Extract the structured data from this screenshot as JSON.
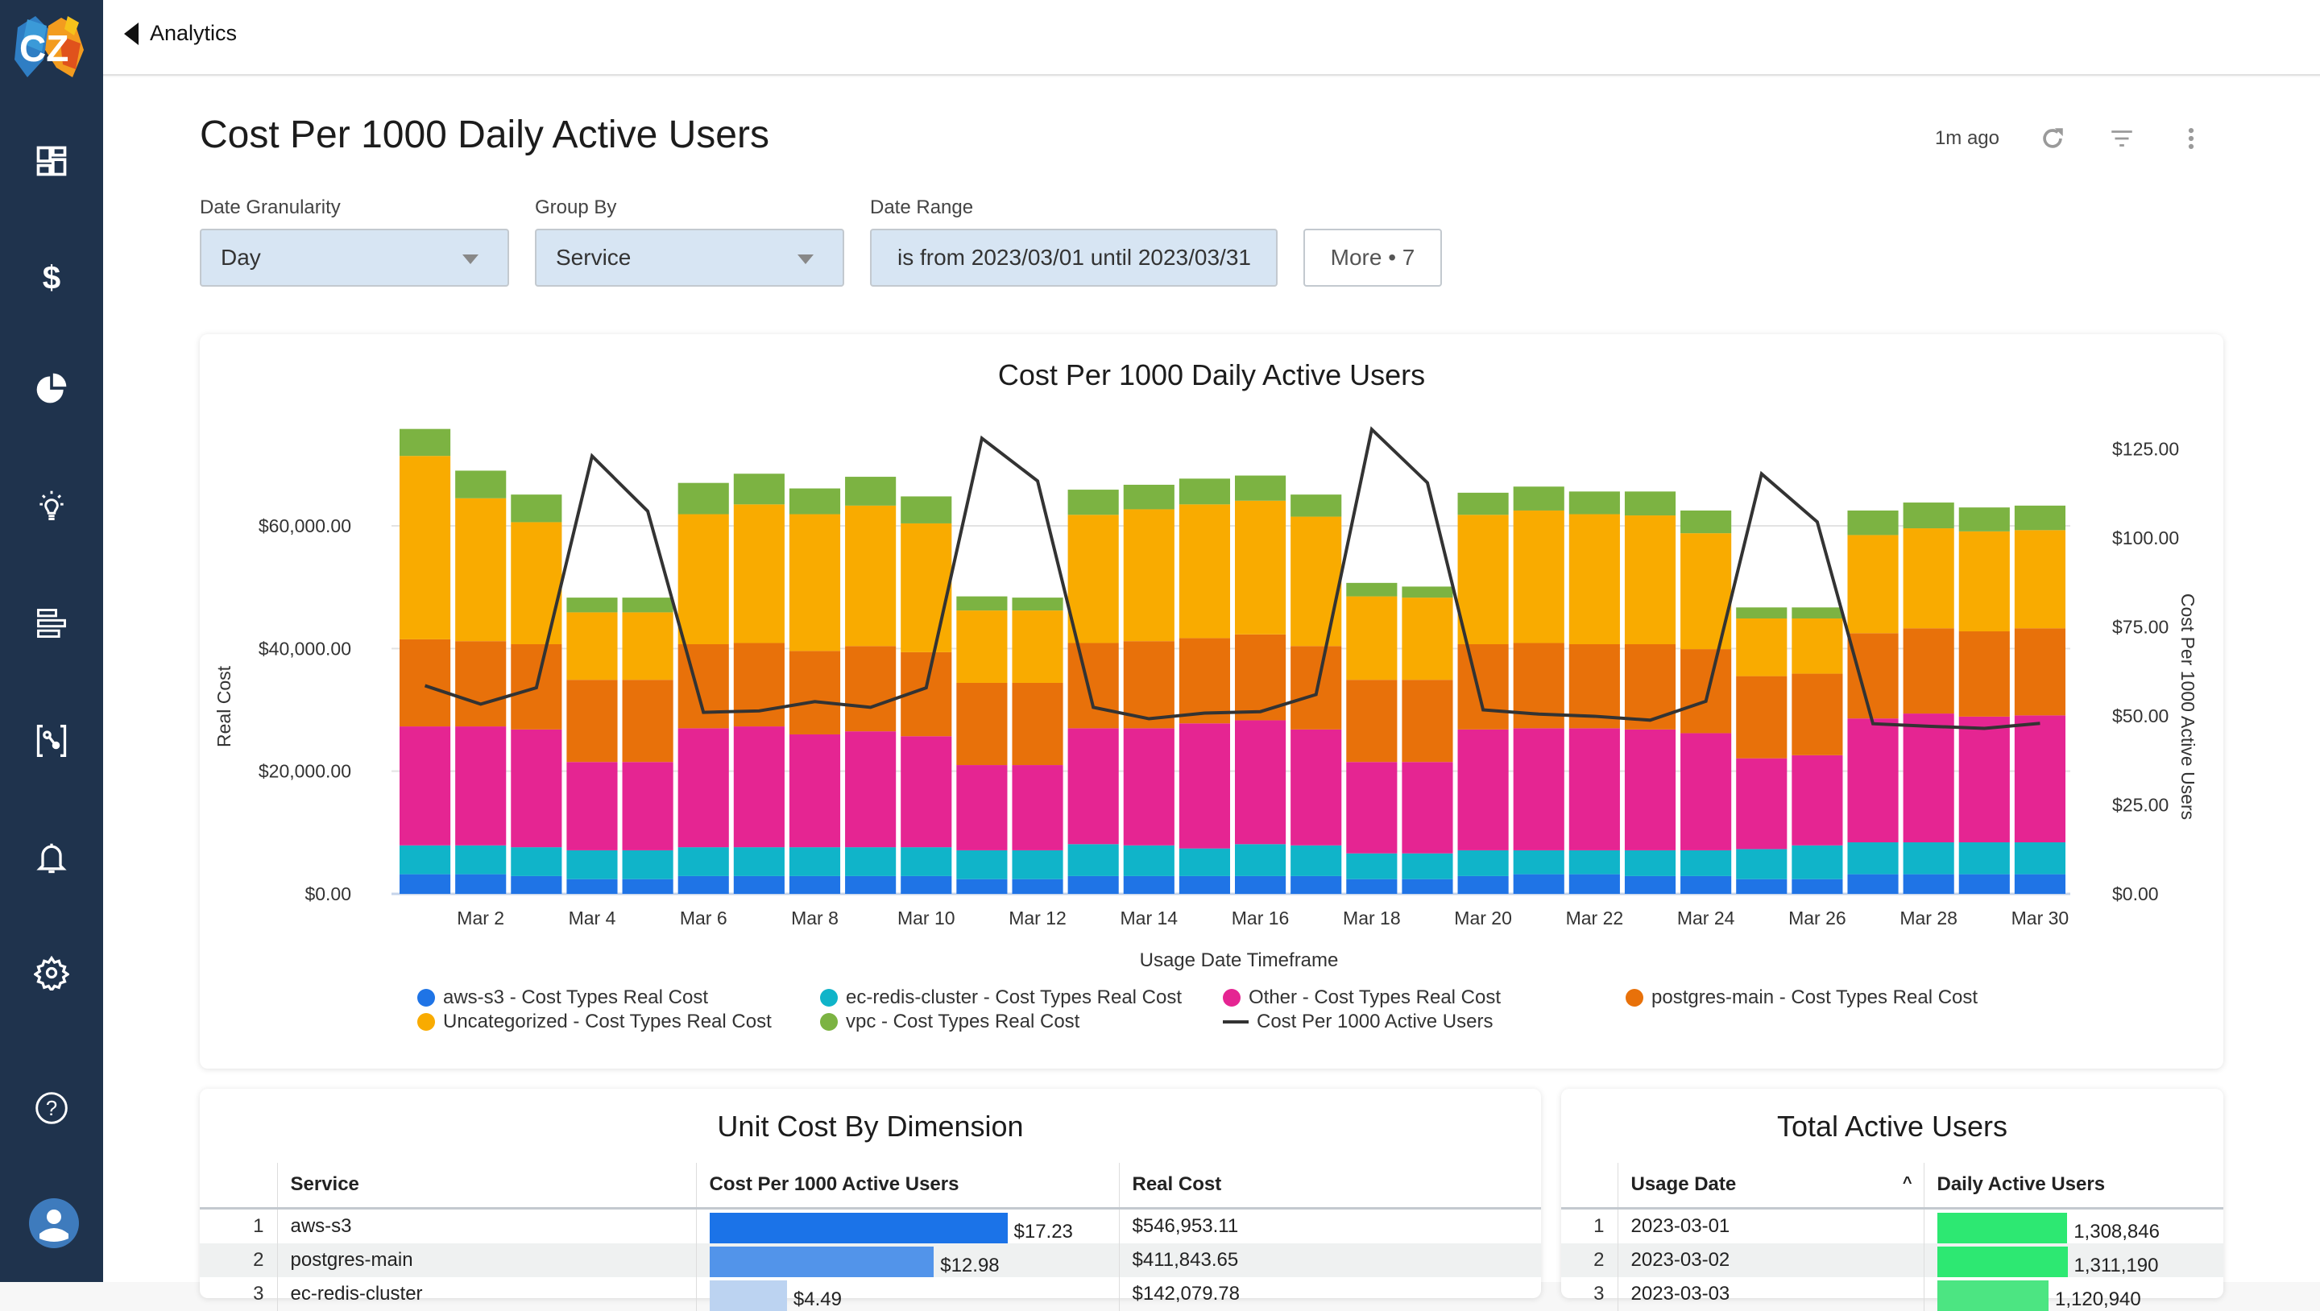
{
  "nav": {
    "back_label": "Analytics",
    "items": [
      {
        "name": "dashboards",
        "icon": "dashboard-grid-icon"
      },
      {
        "name": "costs",
        "icon": "dollar-icon"
      },
      {
        "name": "reports",
        "icon": "pie-chart-icon"
      },
      {
        "name": "insights",
        "icon": "lightbulb-icon"
      },
      {
        "name": "allocation",
        "icon": "bars-icon"
      },
      {
        "name": "unit-metrics",
        "icon": "bracket-node-icon"
      },
      {
        "name": "alerts",
        "icon": "bell-icon"
      },
      {
        "name": "settings",
        "icon": "gear-icon"
      },
      {
        "name": "help",
        "icon": "help-circle-icon"
      }
    ]
  },
  "page": {
    "title": "Cost Per 1000 Daily Active Users",
    "last_updated": "1m ago"
  },
  "filters": {
    "date_granularity": {
      "label": "Date Granularity",
      "value": "Day"
    },
    "group_by": {
      "label": "Group By",
      "value": "Service"
    },
    "date_range": {
      "label": "Date Range",
      "value": "is from 2023/03/01 until 2023/03/31"
    },
    "more_label": "More • 7"
  },
  "chart_data": {
    "type": "bar",
    "stacked": true,
    "title": "Cost Per 1000 Daily Active Users",
    "xlabel": "Usage Date Timeframe",
    "ylabel": "Real Cost",
    "y2label": "Cost Per 1000 Active Users",
    "ylim": [
      0,
      76000
    ],
    "y_ticks": [
      "$0.00",
      "$20,000.00",
      "$40,000.00",
      "$60,000.00"
    ],
    "y_tick_values": [
      0,
      20000,
      40000,
      60000
    ],
    "y2lim": [
      0,
      133
    ],
    "y2_ticks": [
      "$0.00",
      "$25.00",
      "$50.00",
      "$75.00",
      "$100.00",
      "$125.00"
    ],
    "y2_tick_values": [
      0,
      25,
      50,
      75,
      100,
      125
    ],
    "grid": true,
    "legend_position": "bottom",
    "categories": [
      "Mar 1",
      "Mar 2",
      "Mar 3",
      "Mar 4",
      "Mar 5",
      "Mar 6",
      "Mar 7",
      "Mar 8",
      "Mar 9",
      "Mar 10",
      "Mar 11",
      "Mar 12",
      "Mar 13",
      "Mar 14",
      "Mar 15",
      "Mar 16",
      "Mar 17",
      "Mar 18",
      "Mar 19",
      "Mar 20",
      "Mar 21",
      "Mar 22",
      "Mar 23",
      "Mar 24",
      "Mar 25",
      "Mar 26",
      "Mar 27",
      "Mar 28",
      "Mar 29",
      "Mar 30"
    ],
    "x_tick_labels": [
      "Mar 2",
      "Mar 4",
      "Mar 6",
      "Mar 8",
      "Mar 10",
      "Mar 12",
      "Mar 14",
      "Mar 16",
      "Mar 18",
      "Mar 20",
      "Mar 22",
      "Mar 24",
      "Mar 26",
      "Mar 28",
      "Mar 30"
    ],
    "series": [
      {
        "name": "aws-s3 - Cost Types Real Cost",
        "color": "#1f74e6",
        "values": [
          3200,
          3200,
          2900,
          2400,
          2400,
          2900,
          2900,
          2900,
          2900,
          2900,
          2400,
          2400,
          2900,
          2900,
          2900,
          2900,
          2900,
          2400,
          2400,
          2900,
          3200,
          3200,
          2900,
          2900,
          2400,
          2400,
          3200,
          3200,
          3200,
          3200
        ]
      },
      {
        "name": "ec-redis-cluster - Cost Types Real Cost",
        "color": "#10b4c9",
        "values": [
          4700,
          4700,
          4700,
          4700,
          4700,
          4700,
          4700,
          4700,
          4700,
          4700,
          4700,
          4700,
          5200,
          5000,
          4500,
          5200,
          5000,
          4200,
          4200,
          4200,
          3900,
          3900,
          4200,
          4200,
          4900,
          5500,
          5200,
          5200,
          5200,
          5200
        ]
      },
      {
        "name": "Other - Cost Types Real Cost",
        "color": "#e52592",
        "values": [
          19400,
          19400,
          19200,
          14400,
          14400,
          19400,
          19700,
          18400,
          18900,
          18100,
          13900,
          13900,
          18900,
          19100,
          20400,
          20200,
          18900,
          14900,
          14900,
          19700,
          19900,
          19900,
          19700,
          19100,
          14800,
          14700,
          20200,
          21000,
          20500,
          20700
        ]
      },
      {
        "name": "postgres-main - Cost Types Real Cost",
        "color": "#e8710a",
        "values": [
          14200,
          13900,
          13900,
          13400,
          13400,
          13700,
          13600,
          13600,
          13900,
          13700,
          13400,
          13400,
          13900,
          14200,
          13900,
          14000,
          13600,
          13400,
          13400,
          13900,
          13900,
          13700,
          13900,
          13700,
          13400,
          13300,
          13900,
          13900,
          13900,
          14200
        ]
      },
      {
        "name": "Uncategorized - Cost Types Real Cost",
        "color": "#f9ab00",
        "values": [
          29900,
          23300,
          19900,
          11000,
          11000,
          21200,
          22600,
          22300,
          22900,
          21000,
          11800,
          11800,
          20900,
          21500,
          21800,
          21800,
          21100,
          13600,
          13400,
          21100,
          21600,
          21200,
          21000,
          18900,
          9400,
          9000,
          16000,
          16300,
          16300,
          16000
        ]
      },
      {
        "name": "vpc - Cost Types Real Cost",
        "color": "#7cb342",
        "values": [
          4400,
          4500,
          4500,
          2400,
          2400,
          5100,
          5000,
          4200,
          4700,
          4400,
          2300,
          2100,
          4100,
          4000,
          4200,
          4100,
          3600,
          2200,
          1800,
          3600,
          3900,
          3700,
          3900,
          3700,
          1800,
          1800,
          4000,
          4200,
          3900,
          4000
        ]
      },
      {
        "name": "Cost Per 1000 Active Users",
        "color": "#333333",
        "type": "line",
        "axis": "right",
        "values": [
          58.5,
          53.3,
          57.9,
          123.0,
          107.5,
          51.0,
          51.4,
          54.0,
          52.4,
          57.9,
          128.0,
          116.0,
          52.4,
          49.2,
          50.8,
          51.2,
          56.0,
          130.5,
          115.5,
          51.7,
          50.5,
          49.9,
          48.8,
          54.1,
          118.0,
          104.5,
          47.8,
          47.1,
          46.5,
          47.9
        ]
      }
    ]
  },
  "unit_cost_table": {
    "title": "Unit Cost By Dimension",
    "columns": [
      "",
      "Service",
      "Cost Per 1000 Active Users",
      "Real Cost"
    ],
    "rows": [
      {
        "index": "1",
        "service": "aws-s3",
        "cost_per_1000": "$17.23",
        "cost_per_1000_value": 17.23,
        "real_cost": "$546,953.11",
        "bar_color": "#1b73e8"
      },
      {
        "index": "2",
        "service": "postgres-main",
        "cost_per_1000": "$12.98",
        "cost_per_1000_value": 12.98,
        "real_cost": "$411,843.65",
        "bar_color": "#5294ea"
      },
      {
        "index": "3",
        "service": "ec-redis-cluster",
        "cost_per_1000": "$4.49",
        "cost_per_1000_value": 4.49,
        "real_cost": "$142,079.78",
        "bar_color": "#bcd3f1"
      }
    ]
  },
  "active_users_table": {
    "title": "Total Active Users",
    "columns": [
      "",
      "Usage Date",
      "Daily Active Users"
    ],
    "sort_indicator": "^",
    "rows": [
      {
        "index": "1",
        "date": "2023-03-01",
        "users": "1,308,846",
        "users_value": 1308846,
        "bar_color": "#2de872"
      },
      {
        "index": "2",
        "date": "2023-03-02",
        "users": "1,311,190",
        "users_value": 1311190,
        "bar_color": "#2de872"
      },
      {
        "index": "3",
        "date": "2023-03-03",
        "users": "1,120,940",
        "users_value": 1120940,
        "bar_color": "#4ce582"
      }
    ]
  }
}
